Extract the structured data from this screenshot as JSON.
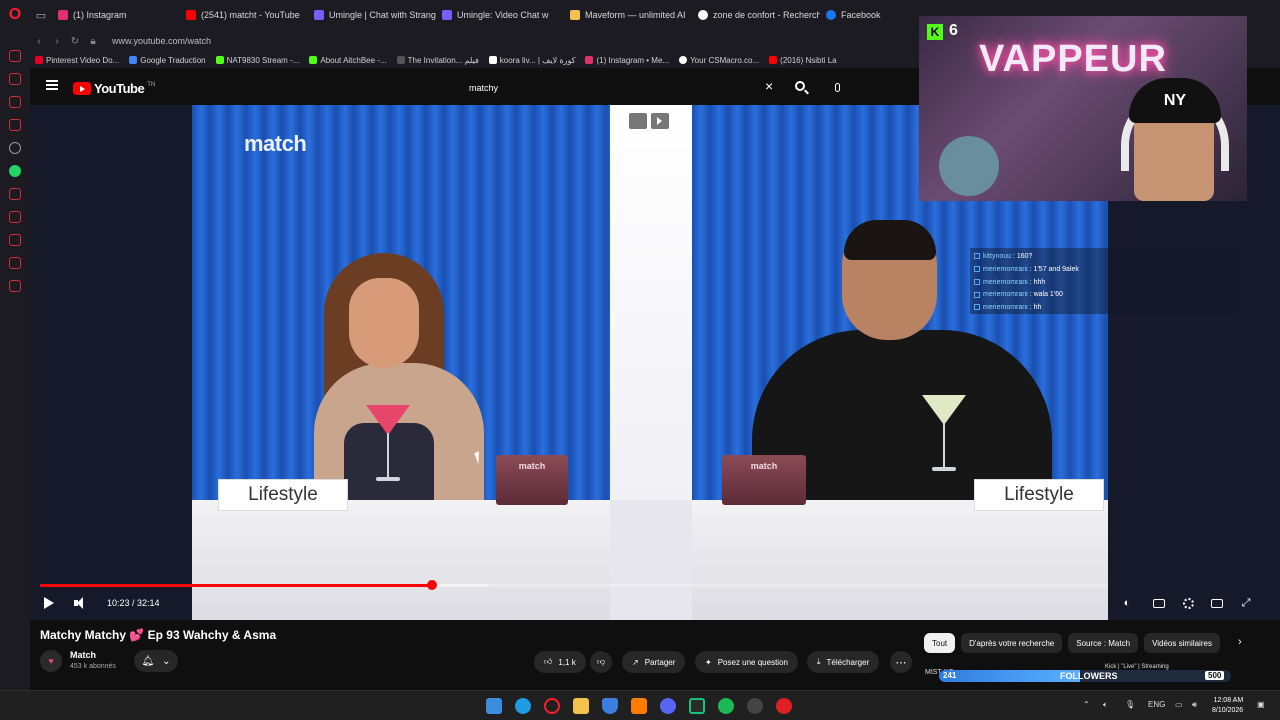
{
  "browser": {
    "tabs": [
      {
        "label": "(1) Instagram",
        "color": "#e1306c"
      },
      {
        "label": "(2541) matcht - YouTube",
        "color": "#ff0000"
      },
      {
        "label": "Umingle | Chat with Strang",
        "color": "#7b5cff"
      },
      {
        "label": "Umingle: Video Chat w",
        "color": "#7b5cff"
      },
      {
        "label": "Maveform — unlimited AI",
        "color": "#f2c14e"
      },
      {
        "label": "zone de confort - Recherch",
        "color": "#ffffff"
      },
      {
        "label": "Facebook",
        "color": "#1877f2"
      }
    ],
    "url": "www.youtube.com/watch",
    "bookmarks": [
      {
        "label": "Pinterest Video Do...",
        "color": "#e60023"
      },
      {
        "label": "Google Traduction",
        "color": "#4285f4"
      },
      {
        "label": "NAT9830 Stream -...",
        "color": "#53fc18"
      },
      {
        "label": "About AitchBee -...",
        "color": "#53fc18"
      },
      {
        "label": "The Invitation... فيلم",
        "color": "#555555"
      },
      {
        "label": "koora liv... | كورة لايف",
        "color": "#ffffff"
      },
      {
        "label": "(1) Instagram • Me...",
        "color": "#e1306c"
      },
      {
        "label": "Your CSMacro.co...",
        "color": "#ffffff"
      },
      {
        "label": "(2016) Nsibti La",
        "color": "#ff0000"
      }
    ]
  },
  "youtube": {
    "logo_text": "YouTube",
    "logo_tm": "TN",
    "search_value": "matchy",
    "player": {
      "brand_text": "match",
      "lifestyle_left": "Lifestyle",
      "lifestyle_right": "Lifestyle",
      "box_label": "match",
      "time_display": "10:23 / 32:14",
      "progress_fraction": 0.3672,
      "buffer_fraction": 0.42
    },
    "video_title": "Matchy Matchy 💕 Ep 93 Wahchy & Asma",
    "channel": {
      "name": "Match",
      "subscribers": "453 k abonnés"
    },
    "actions": {
      "likes": "1,1 k",
      "share": "Partager",
      "ask": "Posez une question",
      "download": "Télécharger"
    },
    "chips": [
      {
        "label": "Tout",
        "active": true
      },
      {
        "label": "D'après votre recherche",
        "active": false
      },
      {
        "label": "Source : Match",
        "active": false
      },
      {
        "label": "Vidéos similaires",
        "active": false
      }
    ]
  },
  "stream_overlay": {
    "neon_sign": "VAPPEUR",
    "kick_badge": "K",
    "viewer_count": "6",
    "cap_logo": "NY",
    "chat": [
      {
        "user": "kittynouu",
        "message": ": 160?"
      },
      {
        "user": "meriemomrani",
        "message": ": 1'57 and 9alek"
      },
      {
        "user": "meriemomrani",
        "message": ": hhh"
      },
      {
        "user": "meriemomrani",
        "message": ": wala 1'60"
      },
      {
        "user": "meriemomrani",
        "message": ": hh"
      }
    ],
    "followers": {
      "prefix": "MIST KO",
      "count": "241",
      "label": "FOLLOWERS",
      "goal": "500",
      "fraction": 0.482,
      "ticker": "Kick | \"Live\" | Streaming"
    }
  },
  "taskbar": {
    "language": "ENG",
    "time": "12:08 AM",
    "date": "8/10/2026"
  }
}
